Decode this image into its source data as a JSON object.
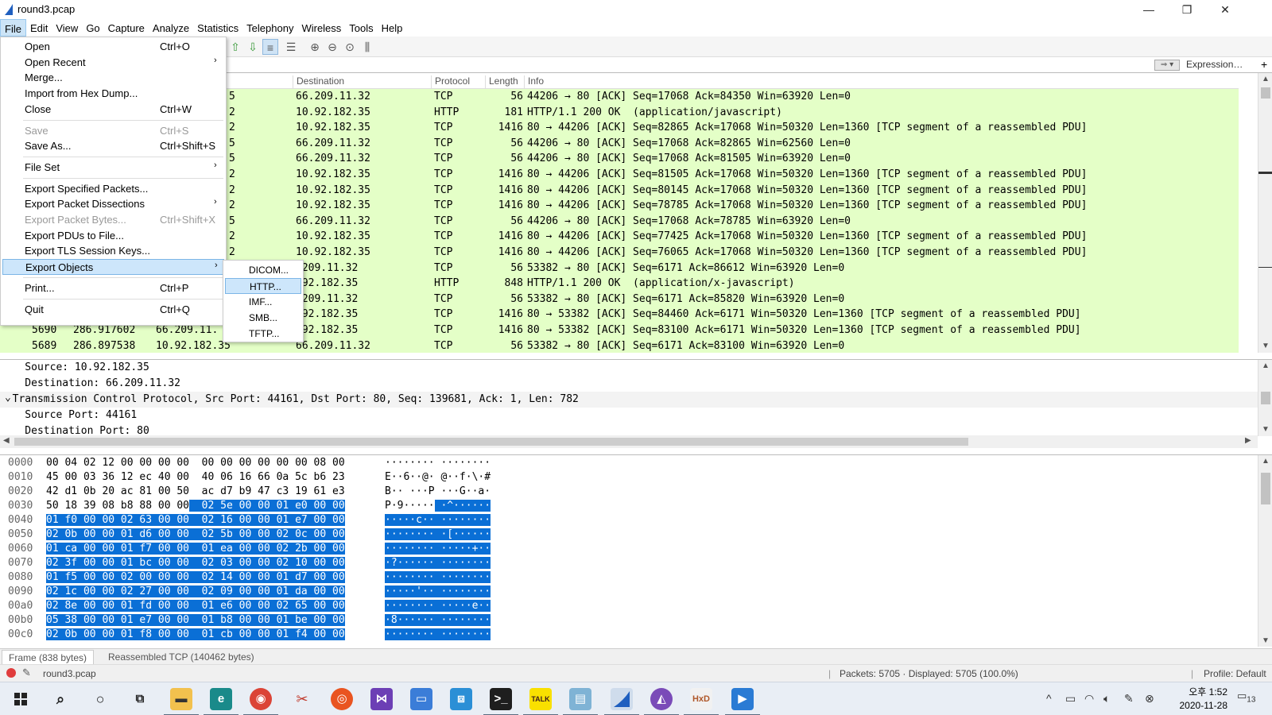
{
  "window": {
    "title": "round3.pcap",
    "minimize": "—",
    "maximize": "❐",
    "close": "✕"
  },
  "menubar": [
    "File",
    "Edit",
    "View",
    "Go",
    "Capture",
    "Analyze",
    "Statistics",
    "Telephony",
    "Wireless",
    "Tools",
    "Help"
  ],
  "file_menu": {
    "items": [
      {
        "label": "Open",
        "shortcut": "Ctrl+O"
      },
      {
        "label": "Open Recent",
        "shortcut": "",
        "submenu": "›"
      },
      {
        "label": "Merge...",
        "shortcut": ""
      },
      {
        "label": "Import from Hex Dump...",
        "shortcut": ""
      },
      {
        "label": "Close",
        "shortcut": "Ctrl+W"
      },
      {
        "label": "Save",
        "shortcut": "Ctrl+S"
      },
      {
        "label": "Save As...",
        "shortcut": "Ctrl+Shift+S"
      },
      {
        "label": "File Set",
        "shortcut": "",
        "submenu": "›"
      },
      {
        "label": "Export Specified Packets...",
        "shortcut": ""
      },
      {
        "label": "Export Packet Dissections",
        "shortcut": "",
        "submenu": "›"
      },
      {
        "label": "Export Packet Bytes...",
        "shortcut": "Ctrl+Shift+X"
      },
      {
        "label": "Export PDUs to File...",
        "shortcut": ""
      },
      {
        "label": "Export TLS Session Keys...",
        "shortcut": ""
      },
      {
        "label": "Export Objects",
        "shortcut": "",
        "submenu": "›"
      },
      {
        "label": "Print...",
        "shortcut": "Ctrl+P"
      },
      {
        "label": "Quit",
        "shortcut": "Ctrl+Q"
      }
    ]
  },
  "export_objects_submenu": [
    "DICOM...",
    "HTTP...",
    "IMF...",
    "SMB...",
    "TFTP..."
  ],
  "filter_bar": {
    "expression_label": "Expression…",
    "add_label": "+"
  },
  "packet_list": {
    "columns": [
      "Destination",
      "Protocol",
      "Length",
      "Info"
    ],
    "rows": [
      {
        "stub": "5",
        "destination": "66.209.11.32",
        "protocol": "TCP",
        "length": "56",
        "info": "44206 → 80 [ACK] Seq=17068 Ack=84350 Win=63920 Len=0"
      },
      {
        "stub": "2",
        "destination": "10.92.182.35",
        "protocol": "HTTP",
        "length": "181",
        "info": "HTTP/1.1 200 OK  (application/javascript)"
      },
      {
        "stub": "2",
        "destination": "10.92.182.35",
        "protocol": "TCP",
        "length": "1416",
        "info": "80 → 44206 [ACK] Seq=82865 Ack=17068 Win=50320 Len=1360 [TCP segment of a reassembled PDU]"
      },
      {
        "stub": "5",
        "destination": "66.209.11.32",
        "protocol": "TCP",
        "length": "56",
        "info": "44206 → 80 [ACK] Seq=17068 Ack=82865 Win=62560 Len=0"
      },
      {
        "stub": "5",
        "destination": "66.209.11.32",
        "protocol": "TCP",
        "length": "56",
        "info": "44206 → 80 [ACK] Seq=17068 Ack=81505 Win=63920 Len=0"
      },
      {
        "stub": "2",
        "destination": "10.92.182.35",
        "protocol": "TCP",
        "length": "1416",
        "info": "80 → 44206 [ACK] Seq=81505 Ack=17068 Win=50320 Len=1360 [TCP segment of a reassembled PDU]"
      },
      {
        "stub": "2",
        "destination": "10.92.182.35",
        "protocol": "TCP",
        "length": "1416",
        "info": "80 → 44206 [ACK] Seq=80145 Ack=17068 Win=50320 Len=1360 [TCP segment of a reassembled PDU]"
      },
      {
        "stub": "2",
        "destination": "10.92.182.35",
        "protocol": "TCP",
        "length": "1416",
        "info": "80 → 44206 [ACK] Seq=78785 Ack=17068 Win=50320 Len=1360 [TCP segment of a reassembled PDU]"
      },
      {
        "stub": "5",
        "destination": "66.209.11.32",
        "protocol": "TCP",
        "length": "56",
        "info": "44206 → 80 [ACK] Seq=17068 Ack=78785 Win=63920 Len=0"
      },
      {
        "stub": "2",
        "destination": "10.92.182.35",
        "protocol": "TCP",
        "length": "1416",
        "info": "80 → 44206 [ACK] Seq=77425 Ack=17068 Win=50320 Len=1360 [TCP segment of a reassembled PDU]"
      },
      {
        "stub": "2",
        "destination": "10.92.182.35",
        "protocol": "TCP",
        "length": "1416",
        "info": "80 → 44206 [ACK] Seq=76065 Ack=17068 Win=50320 Len=1360 [TCP segment of a reassembled PDU]"
      },
      {
        "stub": "",
        "destination": ".209.11.32",
        "protocol": "TCP",
        "length": "56",
        "info": "53382 → 80 [ACK] Seq=6171 Ack=86612 Win=63920 Len=0"
      },
      {
        "stub": "",
        "destination": ".92.182.35",
        "protocol": "HTTP",
        "length": "848",
        "info": "HTTP/1.1 200 OK  (application/x-javascript)"
      },
      {
        "stub": "",
        "destination": ".209.11.32",
        "protocol": "TCP",
        "length": "56",
        "info": "53382 → 80 [ACK] Seq=6171 Ack=85820 Win=63920 Len=0"
      },
      {
        "stub": "",
        "destination": ".92.182.35",
        "protocol": "TCP",
        "length": "1416",
        "info": "80 → 53382 [ACK] Seq=84460 Ack=6171 Win=50320 Len=1360 [TCP segment of a reassembled PDU]"
      },
      {
        "no": "5690",
        "time": "286.917602",
        "source": "66.209.11.",
        "destination": ".92.182.35",
        "protocol": "TCP",
        "length": "1416",
        "info": "80 → 53382 [ACK] Seq=83100 Ack=6171 Win=50320 Len=1360 [TCP segment of a reassembled PDU]"
      },
      {
        "no": "5689",
        "time": "286.897538",
        "source": "10.92.182.35",
        "destination": "66.209.11.32",
        "protocol": "TCP",
        "length": "56",
        "info": "53382 → 80 [ACK] Seq=6171 Ack=83100 Win=63920 Len=0"
      }
    ]
  },
  "details": {
    "lines": [
      "    Source: 10.92.182.35",
      "    Destination: 66.209.11.32",
      "  Transmission Control Protocol, Src Port: 44161, Dst Port: 80, Seq: 139681, Ack: 1, Len: 782",
      "    Source Port: 44161",
      "    Destination Port: 80"
    ],
    "expander": "⌄"
  },
  "bytes": {
    "rows": [
      {
        "off": "0000",
        "hex_a": "00 04 02 12 00 00 00 00",
        "hex_b": "00 00 00 00 00 00 08 00",
        "asc_a": "········",
        "asc_b": "········"
      },
      {
        "off": "0010",
        "hex_a": "45 00 03 36 12 ec 40 00",
        "hex_b": "40 06 16 66 0a 5c b6 23",
        "asc_a": "E··6··@·",
        "asc_b": "@··f·\\·#"
      },
      {
        "off": "0020",
        "hex_a": "42 d1 0b 20 ac 81 00 50",
        "hex_b": "ac d7 b9 47 c3 19 61 e3",
        "asc_a": "B·· ···P",
        "asc_b": "···G··a·"
      },
      {
        "off": "0030",
        "hex_a": "50 18 39 08 b8 88 00 00",
        "hex_b": "02 5e 00 00 01 e0 00 00",
        "asc_a": "P·9·····",
        "asc_b": "·^······"
      },
      {
        "off": "0040",
        "hex_a": "01 f0 00 00 02 63 00 00",
        "hex_b": "02 16 00 00 01 e7 00 00",
        "asc_a": "·····c··",
        "asc_b": "········"
      },
      {
        "off": "0050",
        "hex_a": "02 0b 00 00 01 d6 00 00",
        "hex_b": "02 5b 00 00 02 0c 00 00",
        "asc_a": "········",
        "asc_b": "·[······"
      },
      {
        "off": "0060",
        "hex_a": "01 ca 00 00 01 f7 00 00",
        "hex_b": "01 ea 00 00 02 2b 00 00",
        "asc_a": "········",
        "asc_b": "·····+··"
      },
      {
        "off": "0070",
        "hex_a": "02 3f 00 00 01 bc 00 00",
        "hex_b": "02 03 00 00 02 10 00 00",
        "asc_a": "·?······",
        "asc_b": "········"
      },
      {
        "off": "0080",
        "hex_a": "01 f5 00 00 02 00 00 00",
        "hex_b": "02 14 00 00 01 d7 00 00",
        "asc_a": "········",
        "asc_b": "········"
      },
      {
        "off": "0090",
        "hex_a": "02 1c 00 00 02 27 00 00",
        "hex_b": "02 09 00 00 01 da 00 00",
        "asc_a": "·····'··",
        "asc_b": "········"
      },
      {
        "off": "00a0",
        "hex_a": "02 8e 00 00 01 fd 00 00",
        "hex_b": "01 e6 00 00 02 65 00 00",
        "asc_a": "········",
        "asc_b": "·····e··"
      },
      {
        "off": "00b0",
        "hex_a": "05 38 00 00 01 e7 00 00",
        "hex_b": "01 b8 00 00 01 be 00 00",
        "asc_a": "·8······",
        "asc_b": "········"
      },
      {
        "off": "00c0",
        "hex_a": "02 0b 00 00 01 f8 00 00",
        "hex_b": "01 cb 00 00 01 f4 00 00",
        "asc_a": "········",
        "asc_b": "········"
      }
    ]
  },
  "byte_tabs": [
    "Frame (838 bytes)",
    "Reassembled TCP (140462 bytes)"
  ],
  "statusbar": {
    "file": "round3.pcap",
    "packets": "Packets: 5705 · Displayed: 5705 (100.0%)",
    "profile": "Profile: Default"
  },
  "taskbar": {
    "time": "오후 1:52",
    "date": "2020-11-28",
    "notifications": "13",
    "app_icons": [
      "windows-start-icon",
      "search-icon",
      "cortana-icon",
      "task-view-icon",
      "file-explorer-icon",
      "edge-icon",
      "chrome-icon",
      "snipping-icon",
      "ubuntu-icon",
      "visual-studio-icon",
      "remote-desktop-icon",
      "network-icon",
      "terminal-icon",
      "kakaotalk-icon",
      "notepad-icon",
      "wireshark-icon",
      "visual-studio-purple-icon",
      "hxd-icon",
      "media-player-icon"
    ],
    "kakao_label": "TALK",
    "hxd_label": "HxD"
  },
  "colors": {
    "row_bg": "#e4ffc7",
    "selection": "#0a6fd6",
    "menu_highlight": "#cde6fb"
  }
}
